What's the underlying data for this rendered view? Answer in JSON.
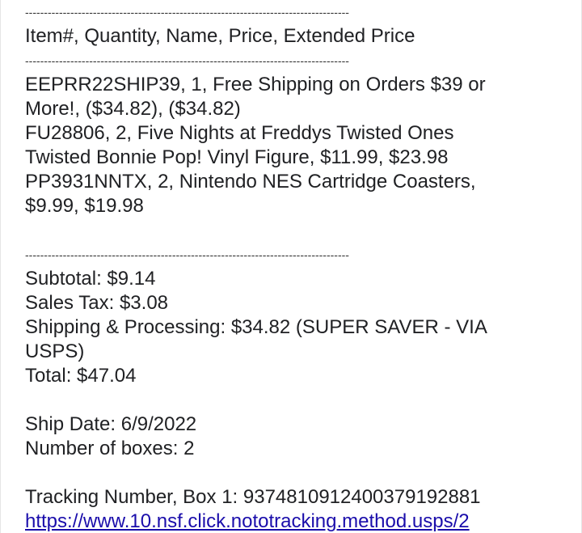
{
  "divider": "--------------------------------------------------------------------------------------",
  "header_row": "Item#,  Quantity,  Name,  Price,  Extended Price",
  "items": [
    {
      "line1": "EEPRR22SHIP39,  1,  Free Shipping on Orders $39 or",
      "line2": "More!,  ($34.82),  ($34.82)"
    },
    {
      "line1": "FU28806,  2,  Five Nights at Freddys Twisted Ones",
      "line2": "Twisted Bonnie Pop! Vinyl Figure,  $11.99,  $23.98"
    },
    {
      "line1": "PP3931NNTX,  2,  Nintendo NES Cartridge Coasters,",
      "line2": "$9.99,  $19.98"
    }
  ],
  "totals": {
    "subtotal": "Subtotal: $9.14",
    "sales_tax": "Sales Tax:  $3.08",
    "shipping_line1": "Shipping & Processing: $34.82 (SUPER SAVER - VIA",
    "shipping_line2": "USPS)",
    "total": "Total: $47.04"
  },
  "shipping": {
    "ship_date": "Ship Date: 6/9/2022",
    "boxes": "Number of boxes: 2",
    "tracking": "Tracking Number, Box 1: 9374810912400379192881",
    "tracking_link": "https://www.10.nsf.click.nototracking.method.usps/2"
  }
}
